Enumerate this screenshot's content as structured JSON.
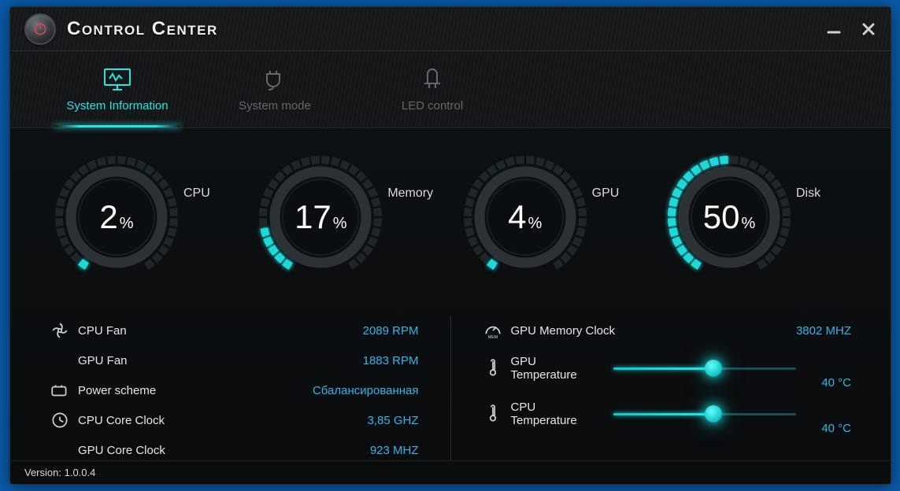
{
  "app": {
    "title": "Control Center"
  },
  "tabs": [
    {
      "label": "System Information"
    },
    {
      "label": "System mode"
    },
    {
      "label": "LED control"
    }
  ],
  "gauges": {
    "cpu": {
      "label": "CPU",
      "value": "2",
      "pct": 2
    },
    "memory": {
      "label": "Memory",
      "value": "17",
      "pct": 17
    },
    "gpu": {
      "label": "GPU",
      "value": "4",
      "pct": 4
    },
    "disk": {
      "label": "Disk",
      "value": "50",
      "pct": 50
    }
  },
  "stats_left": {
    "cpu_fan": {
      "label": "CPU Fan",
      "value": "2089 RPM"
    },
    "gpu_fan": {
      "label": "GPU Fan",
      "value": "1883 RPM"
    },
    "power_scheme": {
      "label": "Power scheme",
      "value": "Сбалансированная"
    },
    "cpu_clock": {
      "label": "CPU Core Clock",
      "value": "3,85 GHZ"
    },
    "gpu_clock": {
      "label": "GPU Core Clock",
      "value": "923 MHZ"
    }
  },
  "stats_right": {
    "gpu_mem_clock": {
      "label": "GPU Memory Clock",
      "value": "3802 MHZ"
    },
    "gpu_temp": {
      "label": "GPU Temperature",
      "value": "40 °C",
      "pct": 55
    },
    "cpu_temp": {
      "label": "CPU Temperature",
      "value": "40 °C",
      "pct": 55
    }
  },
  "footer": {
    "version_label": "Version:",
    "version": "1.0.0.4"
  }
}
